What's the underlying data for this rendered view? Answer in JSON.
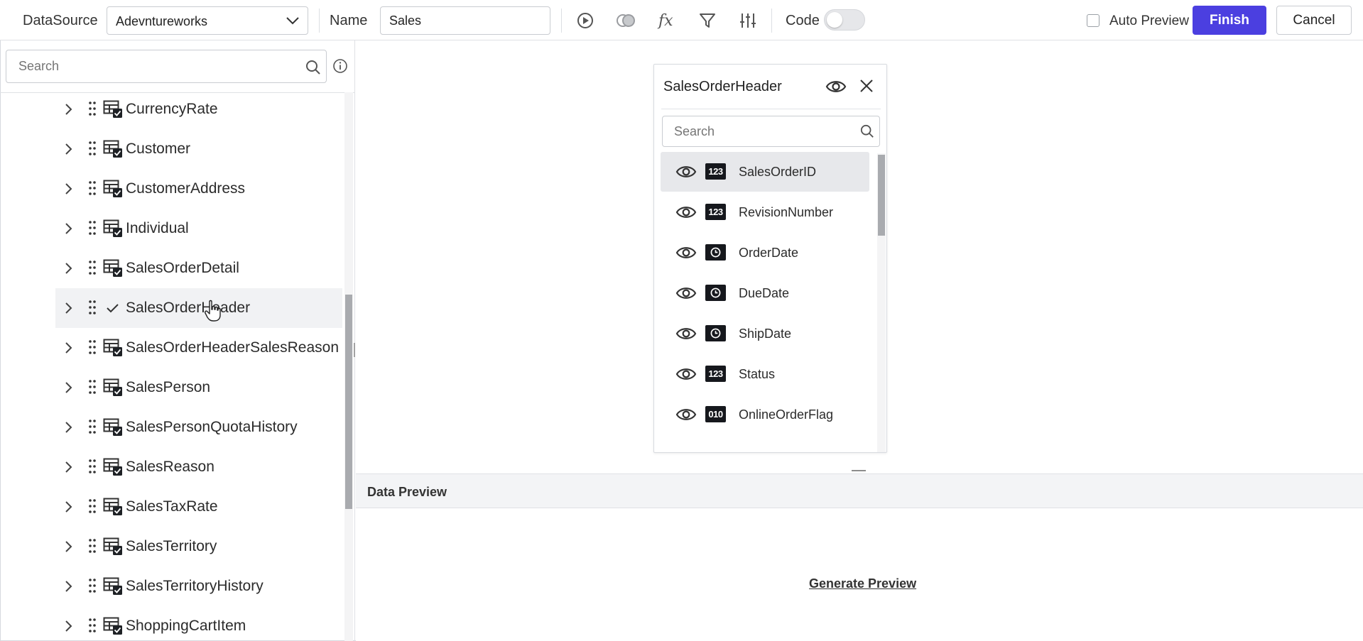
{
  "toolbar": {
    "datasource_label": "DataSource",
    "datasource_value": "Adevntureworks",
    "name_label": "Name",
    "name_value": "Sales",
    "icons": [
      "run-icon",
      "join-icon",
      "expression-icon",
      "filter-icon",
      "settings-sliders-icon"
    ],
    "code_label": "Code",
    "code_enabled": false,
    "auto_preview_label": "Auto Preview",
    "auto_preview_checked": false,
    "finish_label": "Finish",
    "cancel_label": "Cancel",
    "accent_color": "#4b3fe0"
  },
  "left_panel": {
    "search_placeholder": "Search",
    "tables": [
      {
        "label": "CurrencyRate",
        "checked": false
      },
      {
        "label": "Customer",
        "checked": false
      },
      {
        "label": "CustomerAddress",
        "checked": false
      },
      {
        "label": "Individual",
        "checked": false
      },
      {
        "label": "SalesOrderDetail",
        "checked": false
      },
      {
        "label": "SalesOrderHeader",
        "checked": true
      },
      {
        "label": "SalesOrderHeaderSalesReason",
        "checked": false
      },
      {
        "label": "SalesPerson",
        "checked": false
      },
      {
        "label": "SalesPersonQuotaHistory",
        "checked": false
      },
      {
        "label": "SalesReason",
        "checked": false
      },
      {
        "label": "SalesTaxRate",
        "checked": false
      },
      {
        "label": "SalesTerritory",
        "checked": false
      },
      {
        "label": "SalesTerritoryHistory",
        "checked": false
      },
      {
        "label": "ShoppingCartItem",
        "checked": false
      }
    ]
  },
  "table_card": {
    "title": "SalesOrderHeader",
    "search_placeholder": "Search",
    "columns": [
      {
        "label": "SalesOrderID",
        "type": "123"
      },
      {
        "label": "RevisionNumber",
        "type": "123"
      },
      {
        "label": "OrderDate",
        "type": "clock"
      },
      {
        "label": "DueDate",
        "type": "clock"
      },
      {
        "label": "ShipDate",
        "type": "clock"
      },
      {
        "label": "Status",
        "type": "123"
      },
      {
        "label": "OnlineOrderFlag",
        "type": "010"
      }
    ]
  },
  "preview": {
    "title": "Data Preview",
    "generate_label": "Generate Preview"
  }
}
